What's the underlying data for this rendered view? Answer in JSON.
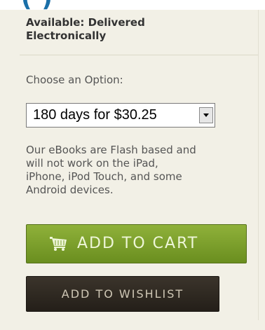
{
  "header_fragment": "(                    )",
  "availability": {
    "line1": "Available: Delivered",
    "line2": "Electronically"
  },
  "option": {
    "label": "Choose an Option:",
    "selected": "180 days for $30.25"
  },
  "notice": {
    "line1": "Our eBooks are Flash based and",
    "line2": "will not work on the iPad,",
    "line3": "iPhone, iPod Touch, and some",
    "line4": "Android devices."
  },
  "buttons": {
    "add_to_cart": "ADD TO CART",
    "add_to_wishlist": "ADD TO WISHLIST"
  },
  "colors": {
    "cart_button": "#7a9f2c",
    "wishlist_button": "#2f2922",
    "panel_background": "#f2f0e6",
    "header_text": "#1a6fa8"
  },
  "icons": {
    "cart": "shopping-cart-icon",
    "dropdown": "chevron-down-icon"
  }
}
